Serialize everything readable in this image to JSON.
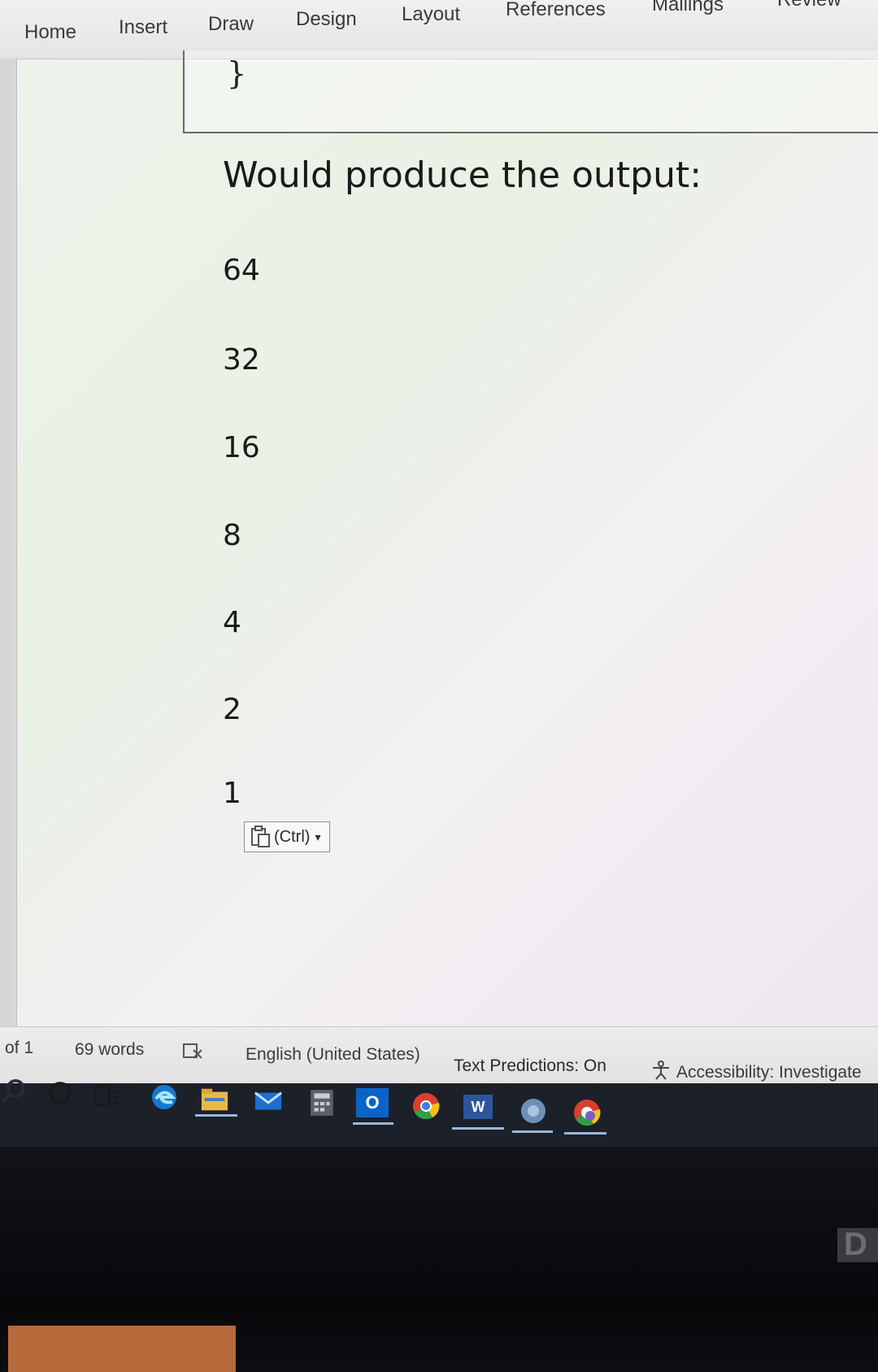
{
  "ribbon": {
    "tabs": [
      {
        "id": "home",
        "label": "Home"
      },
      {
        "id": "insert",
        "label": "Insert"
      },
      {
        "id": "draw",
        "label": "Draw"
      },
      {
        "id": "design",
        "label": "Design"
      },
      {
        "id": "layout",
        "label": "Layout"
      },
      {
        "id": "references",
        "label": "References"
      },
      {
        "id": "mailings",
        "label": "Mailings"
      },
      {
        "id": "review",
        "label": "Review"
      }
    ]
  },
  "document": {
    "code_closing_brace": "}",
    "heading": "Would produce the output:",
    "output_values": [
      "64",
      "32",
      "16",
      "8",
      "4",
      "2",
      "1"
    ],
    "paste_options_label": "(Ctrl)",
    "paste_options_caret": "▾"
  },
  "statusbar": {
    "page_info": "of 1",
    "word_count": "69 words",
    "language": "English (United States)",
    "text_predictions": "Text Predictions: On",
    "accessibility": "Accessibility: Investigate"
  },
  "taskbar": {
    "icons": [
      "search-icon",
      "cortana-icon",
      "task-view-icon",
      "edge-icon",
      "file-explorer-icon",
      "mail-icon",
      "calculator-icon",
      "outlook-icon",
      "chrome-icon",
      "word-icon",
      "app-icon",
      "chrome-profile-icon"
    ],
    "word_label": "W",
    "outlook_label": "O"
  },
  "bezel": {
    "corner_letter": "D"
  },
  "colors": {
    "word_blue": "#2b579a",
    "outlook_blue": "#0a64c8",
    "taskbar": "#1c2029"
  }
}
